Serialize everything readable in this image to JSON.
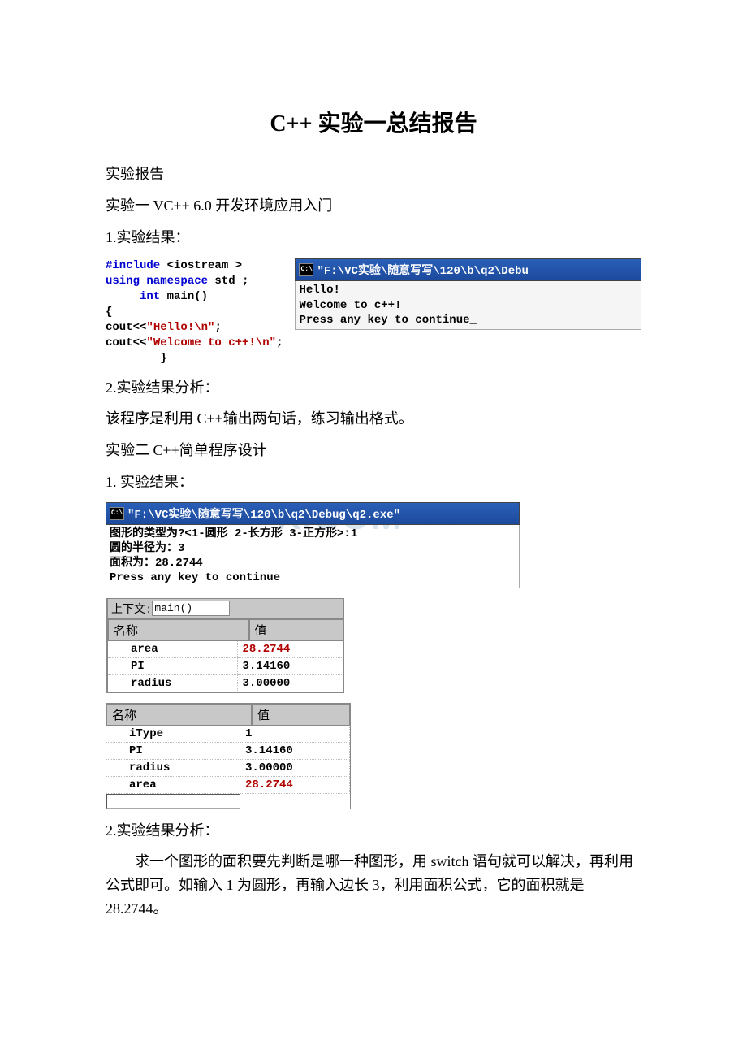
{
  "title_en_left": "C++",
  "title_cn": "实验一总结报告",
  "header_line": "实验报告",
  "exp1_heading": "实验一 VC++ 6.0 开发环境应用入门",
  "exp1_result_label": "1.实验结果：",
  "code1": {
    "l1a": "#include ",
    "l1b": "<iostream >",
    "l2a": "using namespace ",
    "l2b": "std ;",
    "l3a": "     int ",
    "l3b": "main()",
    "l4": "{",
    "l5a": "cout<<",
    "l5b": "\"Hello!\\n\"",
    "l5c": ";",
    "l6a": "cout<<",
    "l6b": "\"Welcome to c++!\\n\"",
    "l6c": ";",
    "l7": "        }"
  },
  "console1_title": "\"F:\\VC实验\\随意写写\\120\\b\\q2\\Debu",
  "console1_body_l1": "Hello!",
  "console1_body_l2": "Welcome to c++!",
  "console1_body_l3": "Press any key to continue",
  "exp1_analysis_label": "2.实验结果分析：",
  "exp1_analysis_text": "该程序是利用 C++输出两句话，练习输出格式。",
  "exp2_heading": "实验二 C++简单程序设计",
  "exp2_result_label": "1. 实验结果：",
  "console2_title": "\"F:\\VC实验\\随意写写\\120\\b\\q2\\Debug\\q2.exe\"",
  "console2_body_l1": "图形的类型为?<1-圆形 2-长方形 3-正方形>:1",
  "console2_body_l2": "圆的半径为：3",
  "console2_body_l3": "面积为：28.2744",
  "console2_body_l4": "Press any key to continue",
  "watermark_text": "X.COM",
  "table1": {
    "context_label": "上下文:",
    "context_value": "main()",
    "col_name": "名称",
    "col_val": "值",
    "rows": [
      {
        "name": "area",
        "val": "28.2744",
        "red": true
      },
      {
        "name": "PI",
        "val": "3.14160",
        "red": false
      },
      {
        "name": "radius",
        "val": "3.00000",
        "red": false
      }
    ]
  },
  "table2": {
    "col_name": "名称",
    "col_val": "值",
    "rows": [
      {
        "name": "iType",
        "val": "1",
        "red": false
      },
      {
        "name": "PI",
        "val": "3.14160",
        "red": false
      },
      {
        "name": "radius",
        "val": "3.00000",
        "red": false
      },
      {
        "name": "area",
        "val": "28.2744",
        "red": true
      }
    ]
  },
  "exp2_analysis_label": "2.实验结果分析：",
  "exp2_analysis_text": "求一个图形的面积要先判断是哪一种图形，用 switch 语句就可以解决，再利用公式即可。如输入 1 为圆形，再输入边长 3，利用面积公式，它的面积就是 28.2744。"
}
